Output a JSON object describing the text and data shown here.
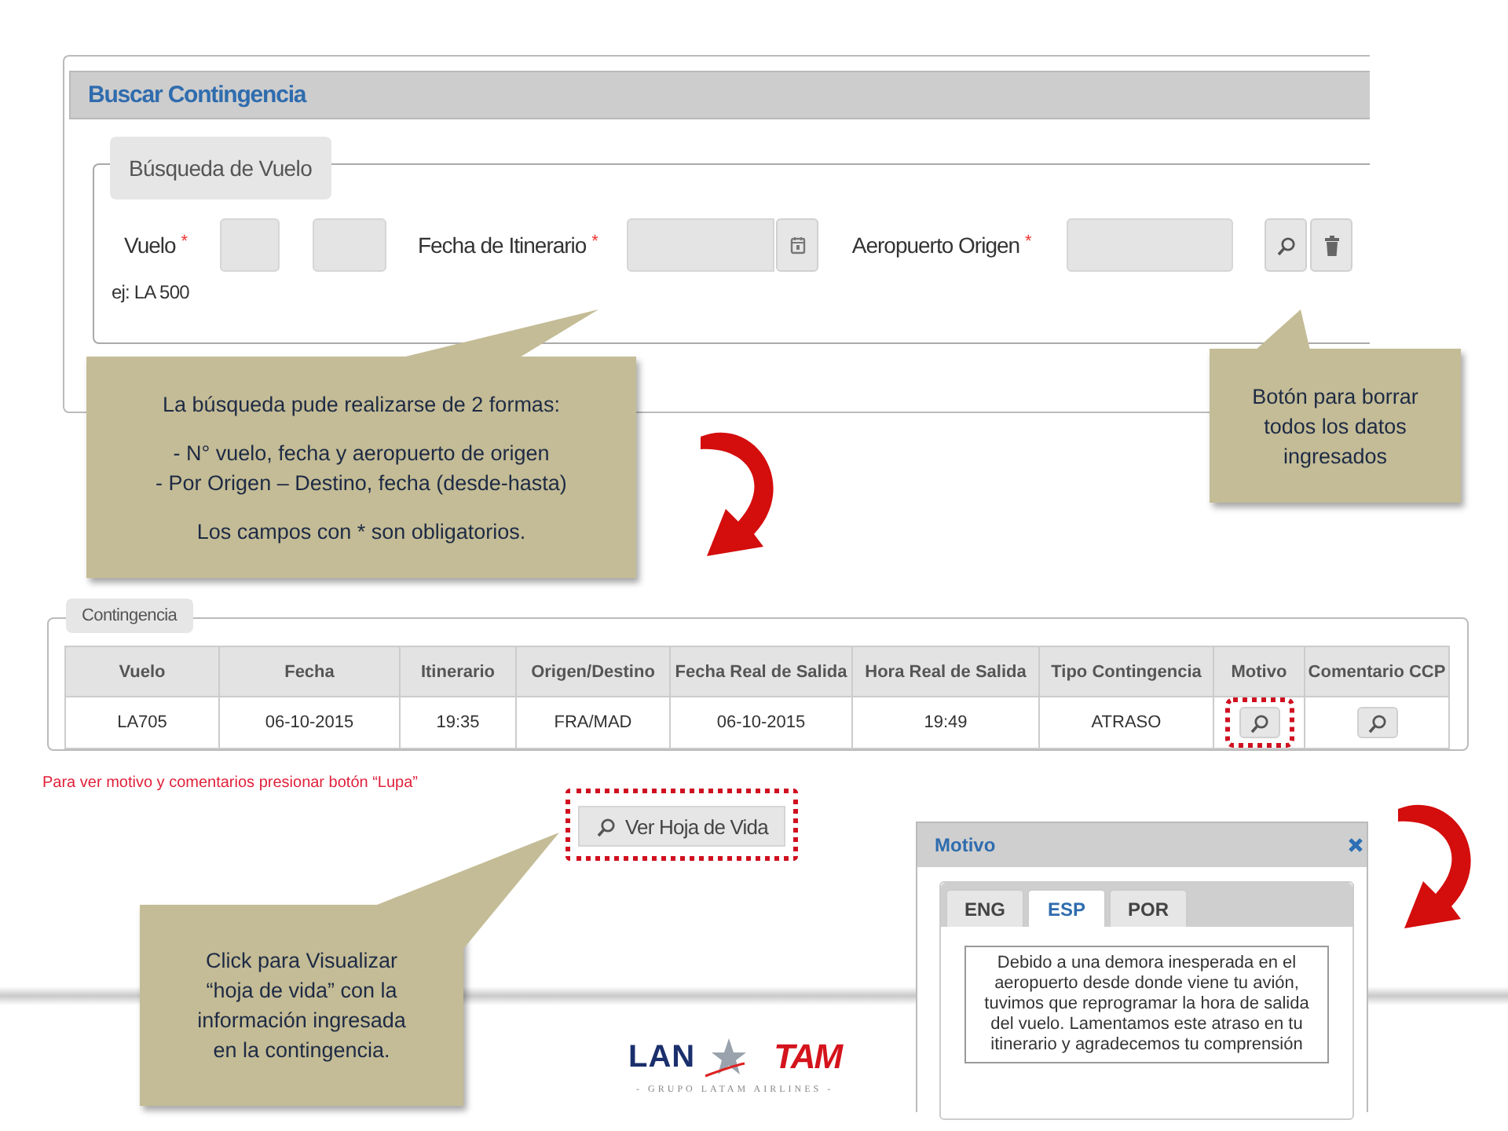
{
  "search_panel": {
    "title": "Buscar Contingencia",
    "legend": "Búsqueda de Vuelo",
    "hint": "ej: LA 500",
    "fields": [
      {
        "kind": "flight",
        "label": "Vuelo",
        "required_mark": "*"
      },
      {
        "kind": "date",
        "label": "Fecha de Itinerario",
        "required_mark": "*"
      },
      {
        "kind": "text",
        "label": "Aeropuerto Origen",
        "required_mark": "*"
      }
    ]
  },
  "callouts": [
    {
      "paragraphs": [
        [
          "La búsqueda pude realizarse de 2 formas:"
        ],
        [
          "- N° vuelo, fecha y aeropuerto de origen",
          "- Por Origen – Destino, fecha (desde-hasta)"
        ],
        [
          "Los campos con * son obligatorios."
        ]
      ]
    },
    {
      "paragraphs": [
        [
          "Botón para borrar",
          "todos los datos",
          "ingresados"
        ]
      ]
    },
    {
      "paragraphs": [
        [
          "Click para Visualizar",
          "“hoja de vida” con la",
          "información ingresada",
          "en la contingencia."
        ]
      ]
    }
  ],
  "results_panel": {
    "legend": "Contingencia",
    "columns": [
      "Vuelo",
      "Fecha",
      "Itinerario",
      "Origen/Destino",
      "Fecha Real de Salida",
      "Hora Real de Salida",
      "Tipo Contingencia",
      "Motivo",
      "Comentario CCP"
    ],
    "rows": [
      [
        {
          "kind": "text",
          "text": "LA705"
        },
        {
          "kind": "text",
          "text": "06-10-2015"
        },
        {
          "kind": "text",
          "text": "19:35"
        },
        {
          "kind": "text",
          "text": "FRA/MAD"
        },
        {
          "kind": "text",
          "text": "06-10-2015"
        },
        {
          "kind": "text",
          "text": "19:49"
        },
        {
          "kind": "text",
          "text": "ATRASO"
        },
        {
          "kind": "button",
          "highlighted": true
        },
        {
          "kind": "button",
          "highlighted": false
        }
      ]
    ]
  },
  "note": "Para ver motivo y comentarios presionar botón “Lupa”",
  "life_button": {
    "label": "Ver Hoja de Vida",
    "highlighted": true
  },
  "dialog": {
    "title": "Motivo",
    "tabs": [
      {
        "label": "ENG",
        "selected": false
      },
      {
        "label": "ESP",
        "selected": true
      },
      {
        "label": "POR",
        "selected": false
      }
    ],
    "text": "Debido a una demora inesperada en el aeropuerto desde donde viene tu avión, tuvimos que reprogramar la hora de salida del vuelo. Lamentamos este atraso en tu itinerario y agradecemos tu comprensión"
  },
  "logo": {
    "left": "LAN",
    "right": "TAM",
    "tagline": "- GRUPO LATAM AIRLINES -"
  }
}
